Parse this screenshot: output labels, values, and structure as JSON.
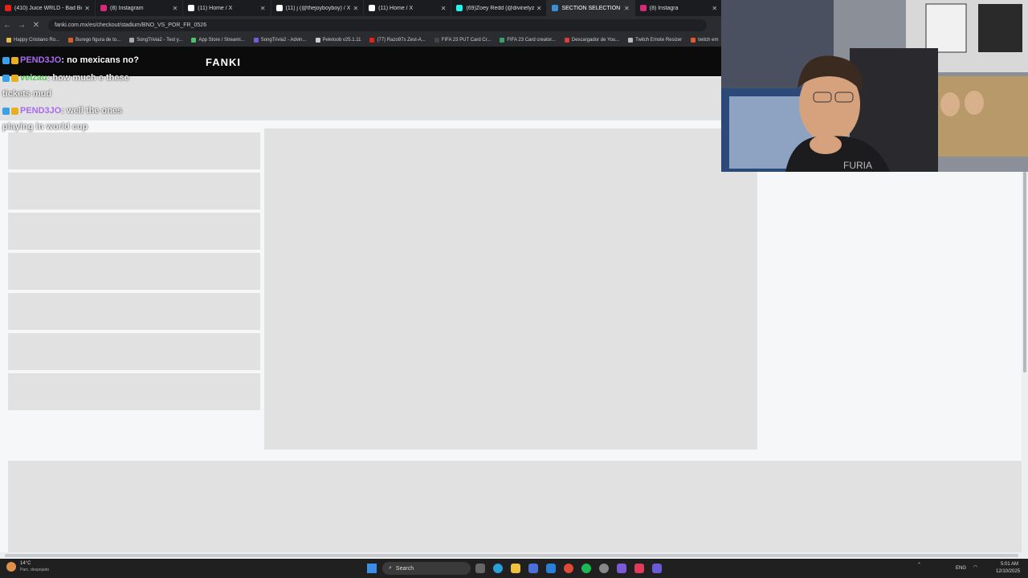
{
  "browser": {
    "tabs": [
      {
        "title": "(410) Juice WRLD - Bad Boy ft",
        "color": "#e62117"
      },
      {
        "title": "(8) Instagram",
        "color": "#d62976"
      },
      {
        "title": "(11) Home / X",
        "color": "#ffffff"
      },
      {
        "title": "(11) j (@thejoyboyboy) / X",
        "color": "#ffffff"
      },
      {
        "title": "(11) Home / X",
        "color": "#ffffff"
      },
      {
        "title": "(69)Zoey Redd (@divinelyzoey",
        "color": "#25f4ee"
      },
      {
        "title": "SECTION SELECTION",
        "color": "#3b8fd6"
      },
      {
        "title": "(8) Instagra",
        "color": "#d62976"
      }
    ],
    "url": "fanki.com.mx/es/checkout/stadium/BNO_VS_POR_FR_0526",
    "bookmarks": [
      {
        "label": "Happy Cristiano Ro...",
        "color": "#e8b84a"
      },
      {
        "label": "Burego figura de to...",
        "color": "#e05a2a"
      },
      {
        "label": "SongTrivia2 - Test y...",
        "color": "#aaaaaa"
      },
      {
        "label": "App Store / Streami...",
        "color": "#4ac46a"
      },
      {
        "label": "SongTrivia2 - Advin...",
        "color": "#7a5ad6"
      },
      {
        "label": "Peletoob v25.1.11",
        "color": "#cccccc"
      },
      {
        "label": "(77) Razo97s Zest-A...",
        "color": "#e62117"
      },
      {
        "label": "FIFA 23 PUT Card Cr...",
        "color": "#444444"
      },
      {
        "label": "FIFA 23 Card creator...",
        "color": "#3aa06a"
      },
      {
        "label": "Descargador de You...",
        "color": "#e03b3b"
      },
      {
        "label": "Twitch Emote Resizer",
        "color": "#bbbbbb"
      },
      {
        "label": "twitch em",
        "color": "#e05a2a"
      }
    ]
  },
  "site": {
    "logo": "FANKI"
  },
  "chat": [
    {
      "user": "PEND3JO",
      "message": ": no mexicans no?",
      "user_color": "#a86bf0",
      "msg_color": "#ffffff"
    },
    {
      "user": "velzau",
      "message": ": how much e these",
      "user_color": "#5cc45c",
      "msg_color": "#f0f0f0"
    },
    {
      "user": "",
      "message": "tickets mud",
      "user_color": "#ffffff",
      "msg_color": "#f0f0f0"
    },
    {
      "user": "PEND3JO",
      "message": ": well the ones",
      "user_color": "#a86bf0",
      "msg_color": "#f0f0f0"
    },
    {
      "user": "",
      "message": "playing in world cup",
      "user_color": "#ffffff",
      "msg_color": "#f0f0f0"
    }
  ],
  "webcam": {
    "jacket_text": "FURIA"
  },
  "taskbar": {
    "search": "Search",
    "weather": "14°C",
    "weather_desc": "Parc. despejado",
    "lang": "ENG",
    "time": "5:01 AM",
    "date": "12/10/2025"
  }
}
